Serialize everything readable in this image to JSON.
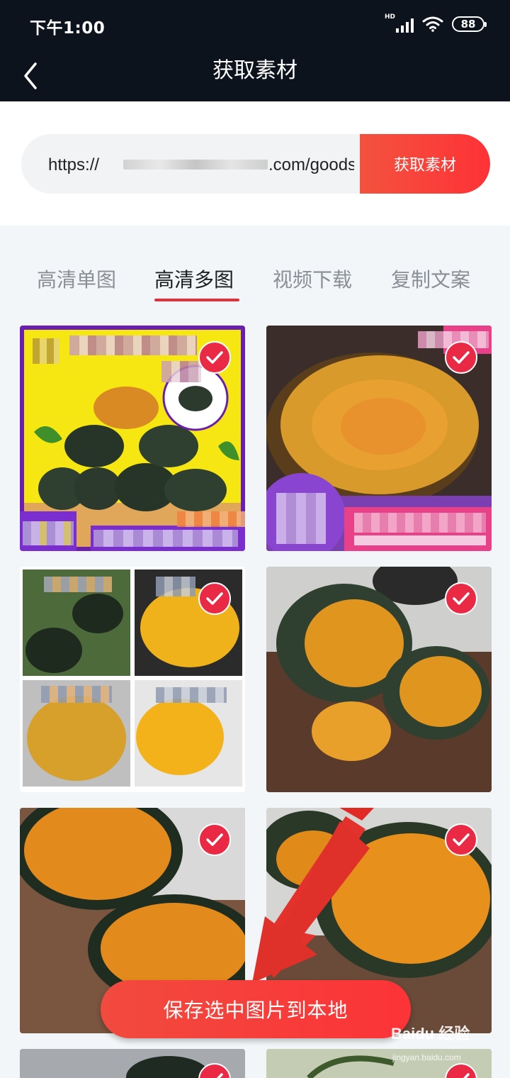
{
  "status": {
    "time": "下午1:00",
    "hd": "HD",
    "battery": "88"
  },
  "nav": {
    "title": "获取素材"
  },
  "search": {
    "url_value": "https://",
    "url_suffix": ".com/goods",
    "button": "获取素材"
  },
  "tabs": [
    {
      "label": "高清单图",
      "active": false
    },
    {
      "label": "高清多图",
      "active": true
    },
    {
      "label": "视频下载",
      "active": false
    },
    {
      "label": "复制文案",
      "active": false
    }
  ],
  "images": [
    {
      "subject": "pumpkin-pyramid-promo",
      "selected": true
    },
    {
      "subject": "pumpkin-cut-half-promo",
      "selected": true
    },
    {
      "subject": "pumpkin-collage",
      "selected": true
    },
    {
      "subject": "steamed-pumpkin",
      "selected": true
    },
    {
      "subject": "pumpkin-halves-board",
      "selected": true
    },
    {
      "subject": "pumpkin-halves-closeup",
      "selected": true
    },
    {
      "subject": "pumpkin-partial",
      "selected": true
    },
    {
      "subject": "pumpkin-partial",
      "selected": true
    }
  ],
  "save_button": "保存选中图片到本地",
  "watermark": {
    "brand": "Baidu 经验",
    "url": "jingyan.baidu.com"
  },
  "colors": {
    "accent": "#ea2a45",
    "header": "#0d131c",
    "tab_underline": "#e62f3b"
  }
}
